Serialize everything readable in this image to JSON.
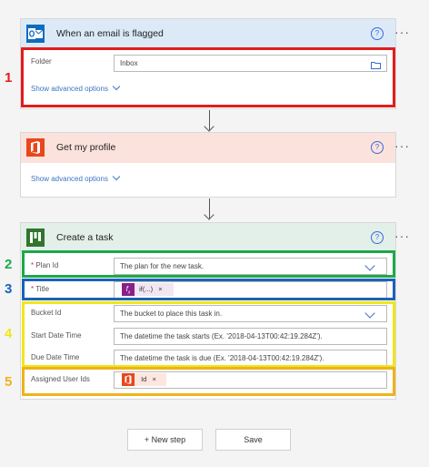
{
  "cards": {
    "trigger": {
      "title": "When an email is flagged",
      "folder_label": "Folder",
      "folder_value": "Inbox",
      "advanced_label": "Show advanced options",
      "header_color": "#dceaf8",
      "icon": "outlook-icon"
    },
    "profile": {
      "title": "Get my profile",
      "advanced_label": "Show advanced options",
      "header_color": "#fbe2dc",
      "icon": "office-icon"
    },
    "task": {
      "title": "Create a task",
      "header_color": "#e3efe9",
      "icon": "planner-icon",
      "fields": {
        "plan_label": "Plan Id",
        "plan_placeholder": "The plan for the new task.",
        "title_label": "Title",
        "title_token": "if(...)",
        "title_token_close": "×",
        "bucket_label": "Bucket Id",
        "bucket_placeholder": "The bucket to place this task in.",
        "start_label": "Start Date Time",
        "start_placeholder": "The datetime the task starts (Ex. '2018-04-13T00:42:19.284Z').",
        "due_label": "Due Date Time",
        "due_placeholder": "The datetime the task is due (Ex. '2018-04-13T00:42:19.284Z').",
        "assigned_label": "Assigned User Ids",
        "assigned_token": "Id",
        "assigned_token_close": "×"
      }
    }
  },
  "common": {
    "help_glyph": "?",
    "more_glyph": "···",
    "required_marker": "*"
  },
  "annotations": [
    {
      "number": "1",
      "color": "#e31c1c"
    },
    {
      "number": "2",
      "color": "#1ea84a"
    },
    {
      "number": "3",
      "color": "#1a63b8"
    },
    {
      "number": "4",
      "color": "#f0e61a"
    },
    {
      "number": "5",
      "color": "#efb21a"
    }
  ],
  "labels": {
    "n1": "1",
    "n2": "2",
    "n3": "3",
    "n4": "4",
    "n5": "5"
  },
  "footer": {
    "new_step_label": "+ New step",
    "save_label": "Save"
  }
}
